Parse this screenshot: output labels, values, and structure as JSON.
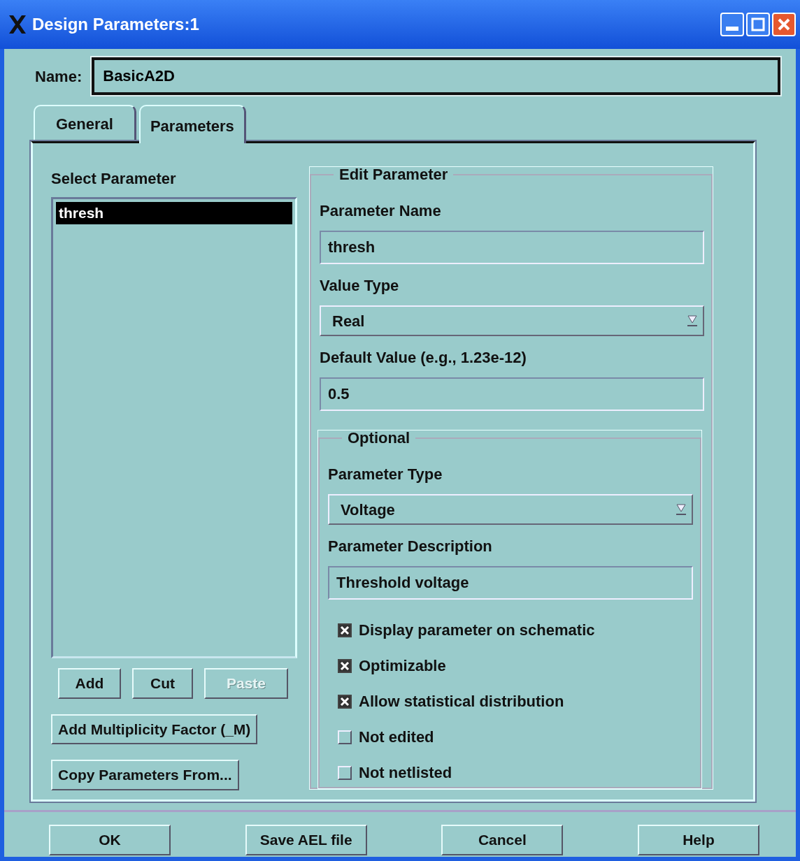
{
  "window": {
    "title": "Design Parameters:1"
  },
  "name_field": {
    "label": "Name:",
    "value": "BasicA2D"
  },
  "tabs": [
    {
      "label": "General",
      "selected": false
    },
    {
      "label": "Parameters",
      "selected": true
    }
  ],
  "select_parameter": {
    "label": "Select Parameter",
    "items": [
      {
        "text": "thresh",
        "selected": true
      }
    ],
    "buttons": [
      {
        "label": "Add",
        "disabled": false
      },
      {
        "label": "Cut",
        "disabled": false
      },
      {
        "label": "Paste",
        "disabled": true
      }
    ],
    "wide_buttons": [
      "Add Multiplicity Factor (_M)",
      "Copy Parameters From..."
    ]
  },
  "edit_parameter": {
    "legend": "Edit Parameter",
    "fields": [
      {
        "label": "Parameter Name",
        "kind": "text",
        "value": "thresh"
      },
      {
        "label": "Value Type",
        "kind": "select",
        "value": "Real"
      },
      {
        "label": "Default Value (e.g., 1.23e-12)",
        "kind": "text",
        "value": "0.5"
      }
    ],
    "optional": {
      "legend": "Optional",
      "fields": [
        {
          "label": "Parameter Type",
          "kind": "select",
          "value": "Voltage"
        },
        {
          "label": "Parameter Description",
          "kind": "text",
          "value": "Threshold voltage"
        }
      ],
      "checkboxes": [
        {
          "label": "Display parameter on schematic",
          "checked": true
        },
        {
          "label": "Optimizable",
          "checked": true
        },
        {
          "label": "Allow statistical distribution",
          "checked": true
        },
        {
          "label": "Not edited",
          "checked": false
        },
        {
          "label": "Not netlisted",
          "checked": false
        }
      ]
    }
  },
  "footer_buttons": [
    "OK",
    "Save AEL file",
    "Cancel",
    "Help"
  ]
}
